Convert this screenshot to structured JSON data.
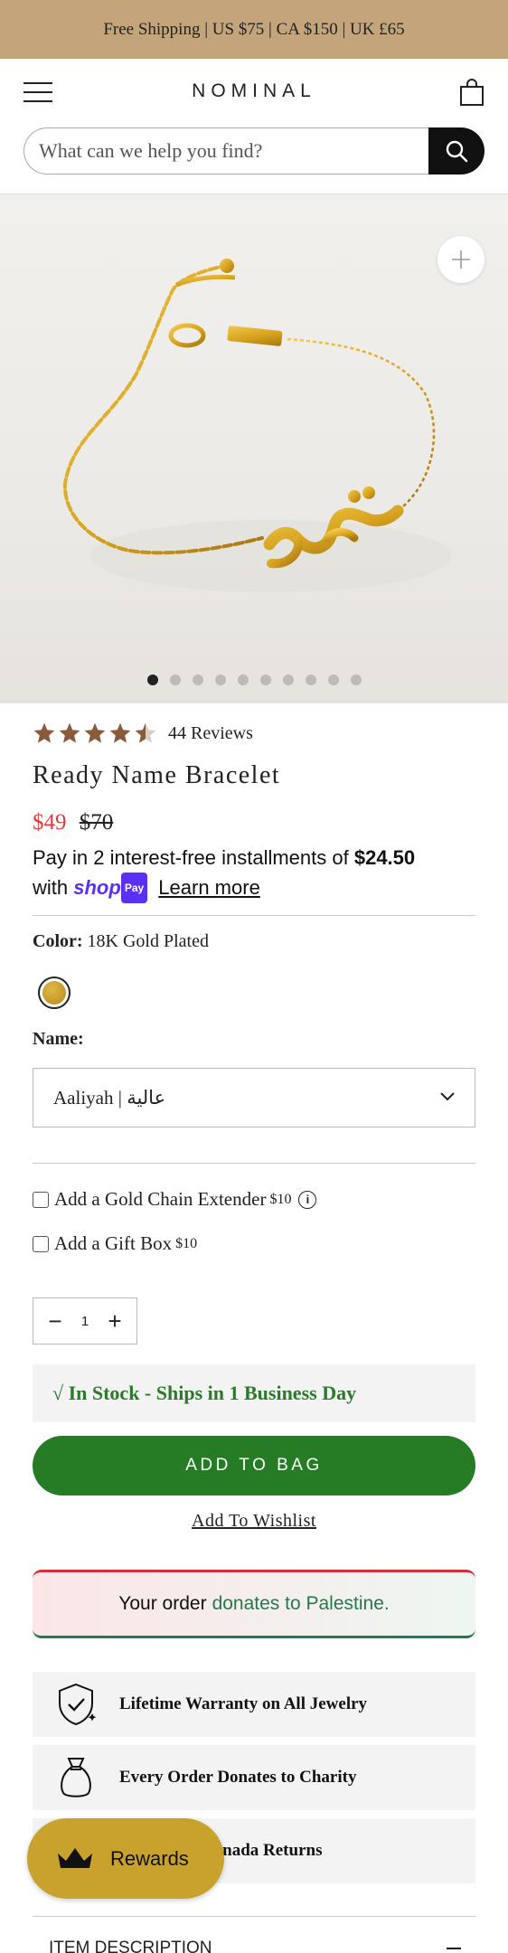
{
  "announcement": "Free Shipping | US $75 | CA $150 | UK £65",
  "header": {
    "logo": "NOMINAL",
    "search_placeholder": "What can we help you find?"
  },
  "gallery": {
    "image_count": 10,
    "active_index": 0
  },
  "product": {
    "rating": 4.5,
    "reviews": "44 Reviews",
    "title": "Ready Name Bracelet",
    "price_sale": "$49",
    "price_original": "$70",
    "installments_prefix": "Pay in 2 interest-free installments of",
    "installments_amount": "$24.50",
    "installments_with": "with",
    "shop_pay_label": "shop",
    "shop_pay_badge": "Pay",
    "learn_more": "Learn more",
    "color_label": "Color:",
    "color_value": "18K Gold Plated",
    "swatch_color": "#c89a2a",
    "name_label": "Name:",
    "name_value": "Aaliyah | عالية",
    "addons": [
      {
        "label": "Add a Gold Chain Extender",
        "price": "$10"
      },
      {
        "label": "Add a Gift Box",
        "price": "$10"
      }
    ],
    "quantity": "1",
    "stock_text": "√  In Stock - Ships in 1 Business Day",
    "add_to_bag": "ADD TO BAG",
    "wishlist": "Add To Wishlist",
    "palestine_prefix": "Your order",
    "palestine_accent": "donates to Palestine.",
    "perks": [
      {
        "icon": "shield-icon",
        "label": "Lifetime Warranty on All Jewelry"
      },
      {
        "icon": "donation-bag-icon",
        "label": "Every Order Donates to Charity"
      },
      {
        "icon": "return-icon",
        "label": "Free US & Canada Returns"
      }
    ]
  },
  "rewards": {
    "label": "Rewards"
  },
  "accordion": {
    "item_description": "ITEM DESCRIPTION"
  },
  "colors": {
    "announcement_bg": "#c4a47a",
    "sale_red": "#e23a3a",
    "add_to_bag_green": "#257c24",
    "stock_green": "#2a7a2a",
    "star_brown": "#8a5a3c",
    "rewards_gold": "#c9a22e"
  }
}
